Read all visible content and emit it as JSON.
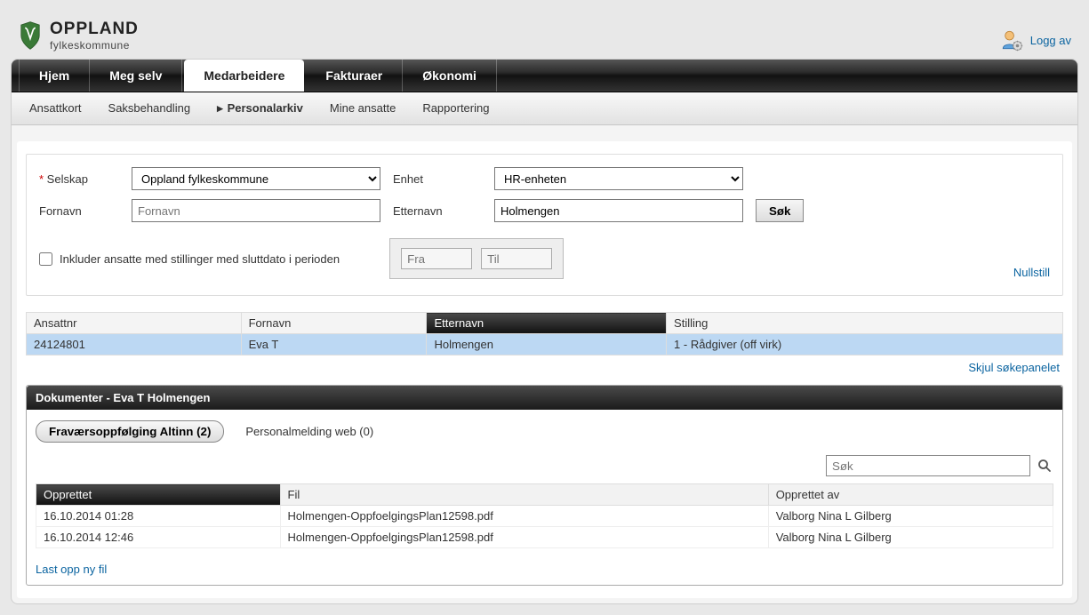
{
  "brand": {
    "line1": "OPPLAND",
    "line2": "fylkeskommune"
  },
  "header": {
    "logoff": "Logg av"
  },
  "tabs": [
    {
      "label": "Hjem"
    },
    {
      "label": "Meg selv"
    },
    {
      "label": "Medarbeidere",
      "active": true
    },
    {
      "label": "Fakturaer"
    },
    {
      "label": "Økonomi"
    }
  ],
  "subtabs": [
    {
      "label": "Ansattkort"
    },
    {
      "label": "Saksbehandling"
    },
    {
      "label": "Personalarkiv",
      "active": true
    },
    {
      "label": "Mine ansatte"
    },
    {
      "label": "Rapportering"
    }
  ],
  "form": {
    "selskap_label": "Selskap",
    "selskap_value": "Oppland fylkeskommune",
    "enhet_label": "Enhet",
    "enhet_value": "HR-enheten",
    "fornavn_label": "Fornavn",
    "fornavn_placeholder": "Fornavn",
    "fornavn_value": "",
    "etternavn_label": "Etternavn",
    "etternavn_value": "Holmengen",
    "search_btn": "Søk",
    "include_label": "Inkluder ansatte med stillinger med sluttdato i perioden",
    "date_from_placeholder": "Fra",
    "date_to_placeholder": "Til",
    "nullstill": "Nullstill"
  },
  "results": {
    "columns": {
      "ansattnr": "Ansattnr",
      "fornavn": "Fornavn",
      "etternavn": "Etternavn",
      "stilling": "Stilling"
    },
    "rows": [
      {
        "ansattnr": "24124801",
        "fornavn": "Eva T",
        "etternavn": "Holmengen",
        "stilling": "1 - Rådgiver (off virk)"
      }
    ],
    "hide_panel": "Skjul søkepanelet"
  },
  "docs": {
    "title": "Dokumenter - Eva T Holmengen",
    "tab_active": "Fraværsoppfølging Altinn (2)",
    "tab_other": "Personalmelding web (0)",
    "search_placeholder": "Søk",
    "columns": {
      "opprettet": "Opprettet",
      "fil": "Fil",
      "opprettet_av": "Opprettet av"
    },
    "rows": [
      {
        "opprettet": "16.10.2014 01:28",
        "fil": "Holmengen-OppfoelgingsPlan12598.pdf",
        "av": "Valborg Nina L Gilberg"
      },
      {
        "opprettet": "16.10.2014 12:46",
        "fil": "Holmengen-OppfoelgingsPlan12598.pdf",
        "av": "Valborg Nina L Gilberg"
      }
    ],
    "upload": "Last opp ny fil"
  }
}
